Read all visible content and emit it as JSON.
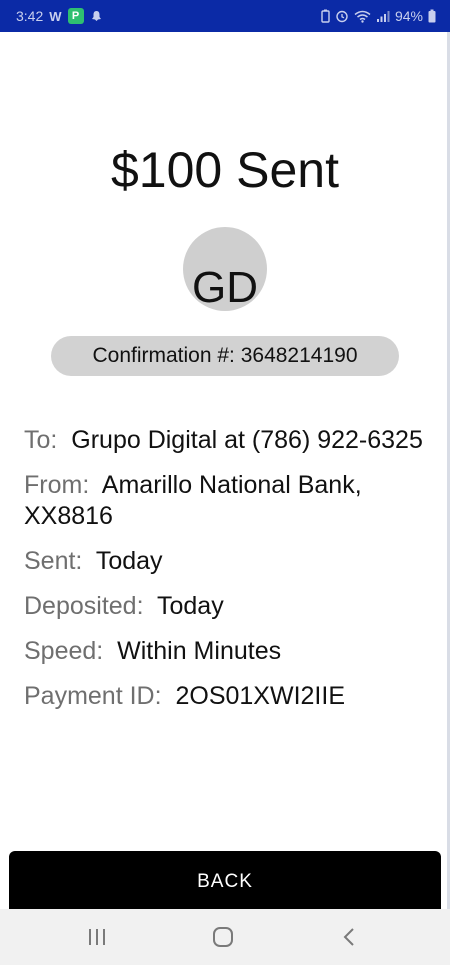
{
  "status_bar": {
    "time": "3:42",
    "carrier": "W",
    "battery": "94%"
  },
  "payment": {
    "title": "$100 Sent",
    "initials": "GD",
    "confirmation": "Confirmation #: 3648214190"
  },
  "details": [
    {
      "label": "To:",
      "value": "Grupo Digital at (786) 922-6325"
    },
    {
      "label": "From:",
      "value": "Amarillo National Bank, XX8816"
    },
    {
      "label": "Sent:",
      "value": "Today"
    },
    {
      "label": "Deposited:",
      "value": "Today"
    },
    {
      "label": "Speed:",
      "value": "Within Minutes"
    },
    {
      "label": "Payment ID:",
      "value": "2OS01XWI2IIE"
    }
  ],
  "back_button": {
    "label": "BACK"
  },
  "colors": {
    "status_bar": "#0b2aa6",
    "pill": "#d2d2d2",
    "avatar": "#cfcfcf",
    "label": "#6f6f6f",
    "button": "#000000"
  },
  "icons": {
    "status_left": [
      "p-app-icon",
      "snapchat-icon"
    ],
    "status_right": [
      "battery-saver-icon",
      "alarm-icon",
      "wifi-icon",
      "signal-icon",
      "battery-icon"
    ],
    "nav": [
      "recent-apps-icon",
      "home-icon",
      "back-icon"
    ]
  }
}
